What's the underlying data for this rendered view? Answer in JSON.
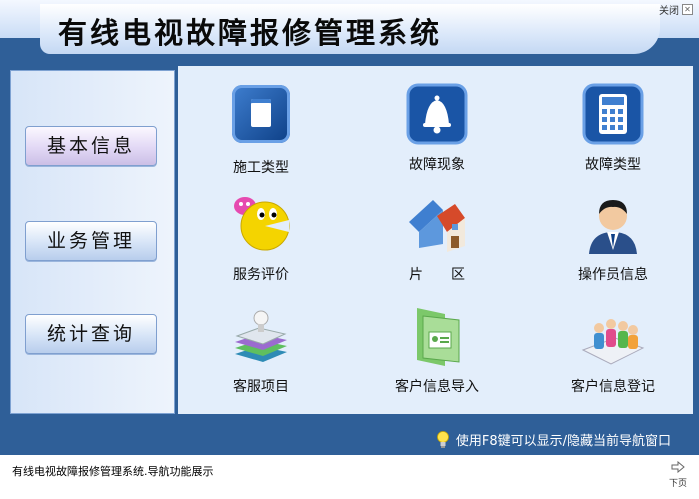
{
  "header": {
    "title": "有线电视故障报修管理系统",
    "close_label": "关闭"
  },
  "sidebar": {
    "items": [
      {
        "label": "基本信息",
        "active": true
      },
      {
        "label": "业务管理",
        "active": false
      },
      {
        "label": "统计查询",
        "active": false
      }
    ]
  },
  "main": {
    "items": [
      {
        "label": "施工类型",
        "icon": "document-icon"
      },
      {
        "label": "故障现象",
        "icon": "bell-icon"
      },
      {
        "label": "故障类型",
        "icon": "calculator-icon"
      },
      {
        "label": "服务评价",
        "icon": "smiley-icon"
      },
      {
        "label": "片　　区",
        "icon": "house-icon"
      },
      {
        "label": "操作员信息",
        "icon": "operator-icon"
      },
      {
        "label": "客服项目",
        "icon": "books-icon"
      },
      {
        "label": "客户信息导入",
        "icon": "folder-import-icon"
      },
      {
        "label": "客户信息登记",
        "icon": "people-icon"
      }
    ]
  },
  "footer": {
    "hint": "使用F8键可以显示/隐藏当前导航窗口"
  },
  "status": {
    "text": "有线电视故障报修管理系统.导航功能展示",
    "next_label": "下页"
  },
  "colors": {
    "frame": "#2f5f98",
    "panel": "#e3eefb",
    "accent": "#0d3f86"
  }
}
